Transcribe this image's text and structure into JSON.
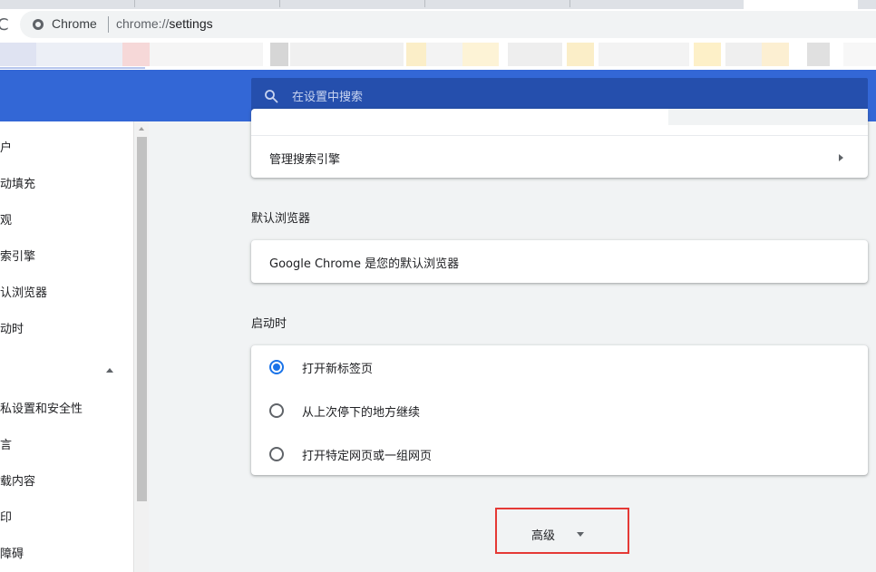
{
  "browser": {
    "omnibox_brand": "Chrome",
    "url_scheme": "chrome://",
    "url_host": "settings",
    "reload_glyph": "C"
  },
  "header": {
    "search_placeholder": "在设置中搜索"
  },
  "sidebar": {
    "items": [
      {
        "label": "户"
      },
      {
        "label": "动填充"
      },
      {
        "label": "观"
      },
      {
        "label": "索引擎"
      },
      {
        "label": "认浏览器"
      },
      {
        "label": "动时"
      },
      {
        "label": "私设置和安全性"
      },
      {
        "label": "言"
      },
      {
        "label": "载内容"
      },
      {
        "label": "印"
      },
      {
        "label": "障碍"
      }
    ]
  },
  "search_engine": {
    "manage_label": "管理搜索引擎"
  },
  "default_browser": {
    "section_title": "默认浏览器",
    "status_text": "Google Chrome 是您的默认浏览器"
  },
  "on_startup": {
    "section_title": "启动时",
    "options": [
      {
        "label": "打开新标签页",
        "checked": true
      },
      {
        "label": "从上次停下的地方继续",
        "checked": false
      },
      {
        "label": "打开特定网页或一组网页",
        "checked": false
      }
    ]
  },
  "advanced": {
    "label": "高级"
  },
  "colors": {
    "header_blue": "#3367d6",
    "search_box_blue": "#254fad",
    "radio_active": "#1a73e8",
    "highlight_red": "#e53935"
  }
}
